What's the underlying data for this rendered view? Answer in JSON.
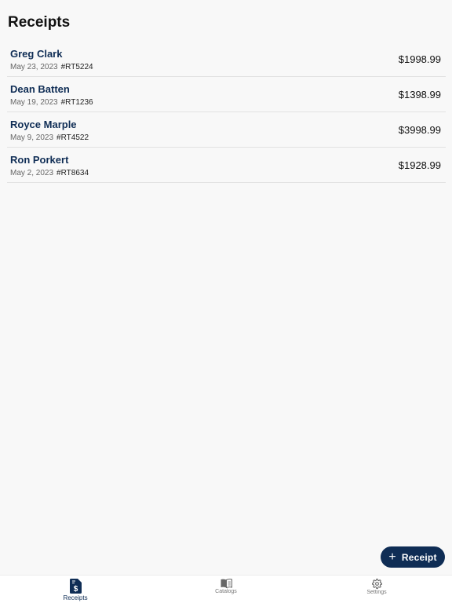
{
  "page": {
    "title": "Receipts"
  },
  "receipts": [
    {
      "name": "Greg Clark",
      "date": "May 23, 2023",
      "ref": "#RT5224",
      "amount": "$1998.99"
    },
    {
      "name": "Dean Batten",
      "date": "May 19, 2023",
      "ref": "#RT1236",
      "amount": "$1398.99"
    },
    {
      "name": "Royce Marple",
      "date": "May 9, 2023",
      "ref": "#RT4522",
      "amount": "$3998.99"
    },
    {
      "name": "Ron Porkert",
      "date": "May 2, 2023",
      "ref": "#RT8634",
      "amount": "$1928.99"
    }
  ],
  "fab": {
    "label": "Receipt",
    "icon": "plus-icon"
  },
  "tabbar": {
    "tabs": [
      {
        "label": "Receipts",
        "icon": "receipt-dollar-icon",
        "active": true
      },
      {
        "label": "Catalogs",
        "icon": "book-icon",
        "active": false
      },
      {
        "label": "Settings",
        "icon": "gear-icon",
        "active": false
      }
    ]
  },
  "colors": {
    "accent": "#0f2d55",
    "background": "#f8f8f8",
    "divider": "#e2e2e2"
  }
}
